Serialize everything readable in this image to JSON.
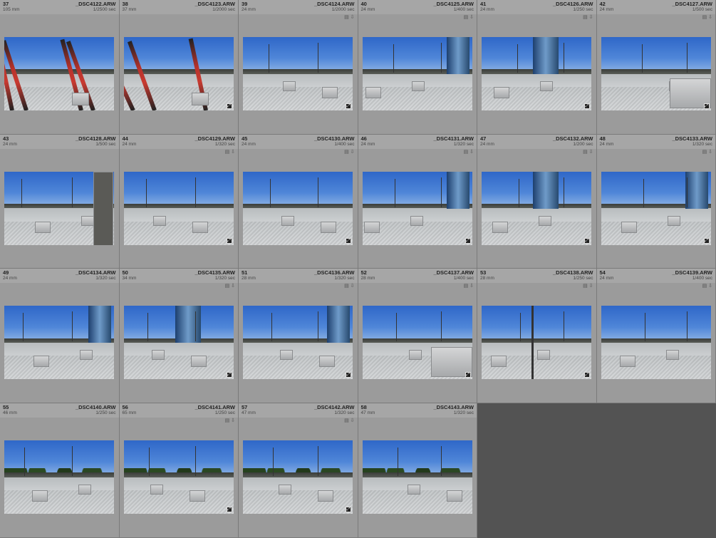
{
  "grid": {
    "columns": 6,
    "photos": [
      {
        "index": "37",
        "filename": "_DSC4122.ARW",
        "focal": "105 mm",
        "shutter": "1/2500 sec",
        "badges": "",
        "scene": "scooters",
        "crop": false
      },
      {
        "index": "38",
        "filename": "_DSC4123.ARW",
        "focal": "37 mm",
        "shutter": "1/2000 sec",
        "badges": "",
        "scene": "scooters2",
        "crop": true
      },
      {
        "index": "39",
        "filename": "_DSC4124.ARW",
        "focal": "24 mm",
        "shutter": "1/2000 sec",
        "badges": "▤ ⇩",
        "scene": "plaza-wide",
        "crop": true
      },
      {
        "index": "40",
        "filename": "_DSC4125.ARW",
        "focal": "24 mm",
        "shutter": "1/400 sec",
        "badges": "▤ ⇩",
        "scene": "plaza-tower",
        "crop": false
      },
      {
        "index": "41",
        "filename": "_DSC4126.ARW",
        "focal": "24 mm",
        "shutter": "1/250 sec",
        "badges": "▤ ⇩",
        "scene": "tower-center",
        "crop": true
      },
      {
        "index": "42",
        "filename": "_DSC4127.ARW",
        "focal": "24 mm",
        "shutter": "1/500 sec",
        "badges": "▤ ⇩",
        "scene": "plaza-block",
        "crop": true
      },
      {
        "index": "43",
        "filename": "_DSC4128.ARW",
        "focal": "24 mm",
        "shutter": "1/500 sec",
        "badges": "",
        "scene": "plaza-pillar",
        "crop": false
      },
      {
        "index": "44",
        "filename": "_DSC4129.ARW",
        "focal": "24 mm",
        "shutter": "1/320 sec",
        "badges": "▤ ⇩",
        "scene": "plaza-wide",
        "crop": true
      },
      {
        "index": "45",
        "filename": "_DSC4130.ARW",
        "focal": "24 mm",
        "shutter": "1/400 sec",
        "badges": "▤ ⇩",
        "scene": "plaza-wide",
        "crop": true
      },
      {
        "index": "46",
        "filename": "_DSC4131.ARW",
        "focal": "24 mm",
        "shutter": "1/320 sec",
        "badges": "▤ ⇩",
        "scene": "plaza-tower",
        "crop": true
      },
      {
        "index": "47",
        "filename": "_DSC4132.ARW",
        "focal": "24 mm",
        "shutter": "1/200 sec",
        "badges": "▤ ⇩",
        "scene": "tower-center",
        "crop": true
      },
      {
        "index": "48",
        "filename": "_DSC4133.ARW",
        "focal": "24 mm",
        "shutter": "1/320 sec",
        "badges": "▤ ⇩",
        "scene": "plaza-tower",
        "crop": true
      },
      {
        "index": "49",
        "filename": "_DSC4134.ARW",
        "focal": "24 mm",
        "shutter": "1/320 sec",
        "badges": "",
        "scene": "plaza-tower",
        "crop": false
      },
      {
        "index": "50",
        "filename": "_DSC4135.ARW",
        "focal": "34 mm",
        "shutter": "1/320 sec",
        "badges": "▤ ⇩",
        "scene": "tower-center",
        "crop": true
      },
      {
        "index": "51",
        "filename": "_DSC4136.ARW",
        "focal": "28 mm",
        "shutter": "1/320 sec",
        "badges": "▤ ⇩",
        "scene": "plaza-tower",
        "crop": true
      },
      {
        "index": "52",
        "filename": "_DSC4137.ARW",
        "focal": "28 mm",
        "shutter": "1/400 sec",
        "badges": "▤ ⇩",
        "scene": "plaza-block",
        "crop": true
      },
      {
        "index": "53",
        "filename": "_DSC4138.ARW",
        "focal": "28 mm",
        "shutter": "1/250 sec",
        "badges": "▤ ⇩",
        "scene": "plaza-pole",
        "crop": true
      },
      {
        "index": "54",
        "filename": "_DSC4139.ARW",
        "focal": "24 mm",
        "shutter": "1/400 sec",
        "badges": "▤ ⇩",
        "scene": "plaza-wide",
        "crop": false
      },
      {
        "index": "55",
        "filename": "_DSC4140.ARW",
        "focal": "46 mm",
        "shutter": "1/250 sec",
        "badges": "",
        "scene": "trees-plaza",
        "crop": false
      },
      {
        "index": "56",
        "filename": "_DSC4141.ARW",
        "focal": "65 mm",
        "shutter": "1/250 sec",
        "badges": "▤ ⇩",
        "scene": "trees-plaza",
        "crop": true
      },
      {
        "index": "57",
        "filename": "_DSC4142.ARW",
        "focal": "47 mm",
        "shutter": "1/320 sec",
        "badges": "▤ ⇩",
        "scene": "trees-plaza",
        "crop": true
      },
      {
        "index": "58",
        "filename": "_DSC4143.ARW",
        "focal": "47 mm",
        "shutter": "1/320 sec",
        "badges": "",
        "scene": "trees-plaza",
        "crop": false
      }
    ]
  },
  "colors": {
    "background": "#535353",
    "cell": "#9b9b9b",
    "cell_header": "#a6a6a6",
    "sky": "#3f78d0",
    "scooter_red": "#c83a30",
    "glass_tower": "#2b5d96"
  }
}
